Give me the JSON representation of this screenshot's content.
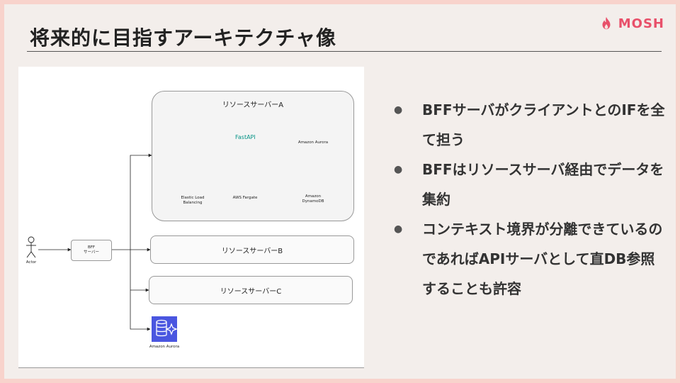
{
  "slide": {
    "title": "将来的に目指すアーキテクチャ像",
    "brand": "MOSH",
    "bullets": [
      "BFFサーバがクライアントとのIFを全て担う",
      "BFFはリソースサーバ経由でデータを集約",
      "コンテキスト境界が分離できているのであればAPIサーバとして直DB参照することも許容"
    ]
  },
  "diagram": {
    "actor": "Actor",
    "bff_line1": "BFF",
    "bff_line2": "サーバー",
    "server_a": "リソースサーバーA",
    "server_b": "リソースサーバーB",
    "server_c": "リソースサーバーC",
    "fastapi": "FastAPI",
    "elb_line1": "Elastic Load",
    "elb_line2": "Balancing",
    "fargate": "AWS Fargate",
    "aurora": "Amazon Aurora",
    "dynamo_line1": "Amazon",
    "dynamo_line2": "DynamoDB",
    "aurora_bottom": "Amazon Aurora"
  },
  "colors": {
    "accent": "#e8506a",
    "elb": "#f0801e",
    "fargate": "#f0801e",
    "database": "#4a56e0",
    "fastapi": "#059486",
    "docker": "#2496ed"
  }
}
